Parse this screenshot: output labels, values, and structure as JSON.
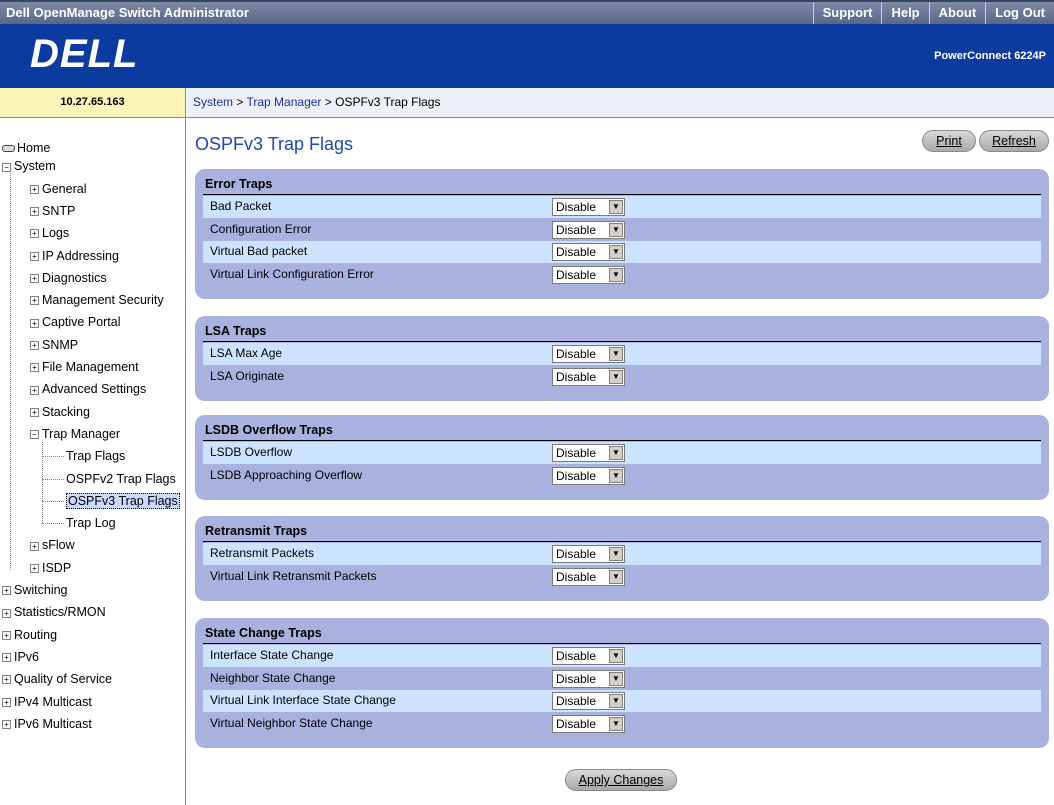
{
  "topbar": {
    "title": "Dell OpenManage Switch Administrator",
    "links": [
      "Support",
      "Help",
      "About",
      "Log Out"
    ]
  },
  "banner": {
    "logo": "DELL",
    "model": "PowerConnect 6224P"
  },
  "ip_address": "10.27.65.163",
  "breadcrumb": {
    "system": "System",
    "sep1": " > ",
    "trap_manager": "Trap Manager",
    "sep2": " > ",
    "current": "OSPFv3 Trap Flags"
  },
  "sidebar": {
    "home": "Home",
    "system": "System",
    "system_children": [
      "General",
      "SNTP",
      "Logs",
      "IP Addressing",
      "Diagnostics",
      "Management Security",
      "Captive Portal",
      "SNMP",
      "File Management",
      "Advanced Settings",
      "Stacking",
      "Trap Manager"
    ],
    "trap_children": [
      "Trap Flags",
      "OSPFv2 Trap Flags",
      "OSPFv3 Trap Flags",
      "Trap Log"
    ],
    "system_children_after": [
      "sFlow",
      "ISDP"
    ],
    "top_level": [
      "Switching",
      "Statistics/RMON",
      "Routing",
      "IPv6",
      "Quality of Service",
      "IPv4 Multicast",
      "IPv6 Multicast"
    ],
    "selected": "OSPFv3 Trap Flags"
  },
  "page": {
    "title": "OSPFv3 Trap Flags",
    "print": "Print",
    "refresh": "Refresh",
    "apply": "Apply Changes"
  },
  "sections": [
    {
      "title": "Error Traps",
      "rows": [
        {
          "label": "Bad Packet",
          "value": "Disable"
        },
        {
          "label": "Configuration Error",
          "value": "Disable"
        },
        {
          "label": "Virtual Bad packet",
          "value": "Disable"
        },
        {
          "label": "Virtual Link Configuration Error",
          "value": "Disable"
        }
      ]
    },
    {
      "title": "LSA Traps",
      "rows": [
        {
          "label": "LSA Max Age",
          "value": "Disable"
        },
        {
          "label": "LSA Originate",
          "value": "Disable"
        }
      ]
    },
    {
      "title": "LSDB Overflow Traps",
      "rows": [
        {
          "label": "LSDB Overflow",
          "value": "Disable"
        },
        {
          "label": "LSDB Approaching Overflow",
          "value": "Disable"
        }
      ]
    },
    {
      "title": "Retransmit Traps",
      "rows": [
        {
          "label": "Retransmit Packets",
          "value": "Disable"
        },
        {
          "label": "Virtual Link Retransmit Packets",
          "value": "Disable"
        }
      ]
    },
    {
      "title": "State Change Traps",
      "rows": [
        {
          "label": "Interface State Change",
          "value": "Disable"
        },
        {
          "label": "Neighbor State Change",
          "value": "Disable"
        },
        {
          "label": "Virtual Link Interface State Change",
          "value": "Disable"
        },
        {
          "label": "Virtual Neighbor State Change",
          "value": "Disable"
        }
      ]
    }
  ],
  "colors": {
    "banner": "#0b3b9e",
    "section": "#a9b1df",
    "row_alt": "#cbe3ff",
    "title": "#1b49b4"
  }
}
